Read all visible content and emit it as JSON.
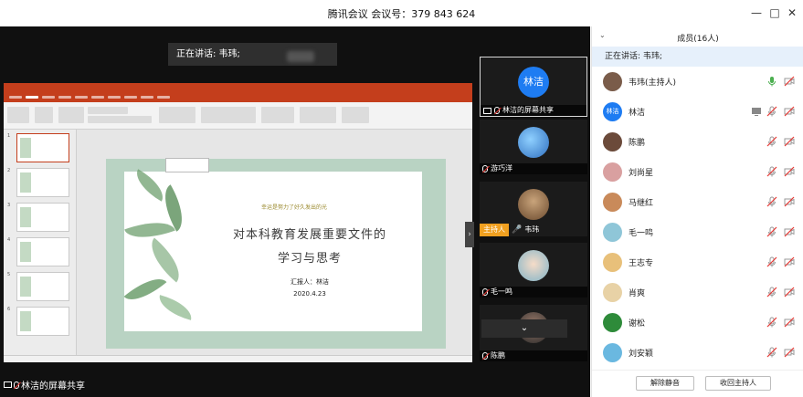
{
  "window": {
    "title": "腾讯会议 会议号：379 843 624"
  },
  "stage": {
    "speaking_prefix": "正在讲话: 韦玮;",
    "share_label": "林洁的屏幕共享"
  },
  "slide": {
    "kicker": "幸运是努力了好久发出的光",
    "title_line1": "对本科教育发展重要文件的",
    "title_line2": "学习与思考",
    "reporter": "汇报人：林洁",
    "date": "2020.4.23"
  },
  "tiles": [
    {
      "name": "林洁的屏幕共享",
      "avatar_text": "林洁"
    },
    {
      "name": "游巧洋"
    },
    {
      "name": "韦玮",
      "host_tag": "主持人"
    },
    {
      "name": "毛一鸣"
    },
    {
      "name": "陈鹏"
    }
  ],
  "panel": {
    "title": "成员(16人)",
    "speaking": "正在讲话: 韦玮;",
    "members": [
      {
        "name": "韦玮(主持人)",
        "mic": "on"
      },
      {
        "name": "林洁",
        "avatar_text": "林洁",
        "mic": "muted",
        "sharing": true
      },
      {
        "name": "陈鹏",
        "mic": "muted"
      },
      {
        "name": "刘尚星",
        "mic": "muted"
      },
      {
        "name": "马继红",
        "mic": "muted"
      },
      {
        "name": "毛一鸣",
        "mic": "muted"
      },
      {
        "name": "王志专",
        "mic": "muted"
      },
      {
        "name": "肖爽",
        "mic": "muted"
      },
      {
        "name": "谢松",
        "mic": "muted"
      },
      {
        "name": "刘安颖",
        "mic": "muted"
      }
    ],
    "unmute_button": "解除静音",
    "reclaim_host_button": "收回主持人"
  },
  "colors": {
    "accent": "#1e7cf2",
    "host": "#f0a020",
    "ppt": "#c43e1c",
    "muted": "#e53935",
    "mic_on": "#4caf50"
  }
}
